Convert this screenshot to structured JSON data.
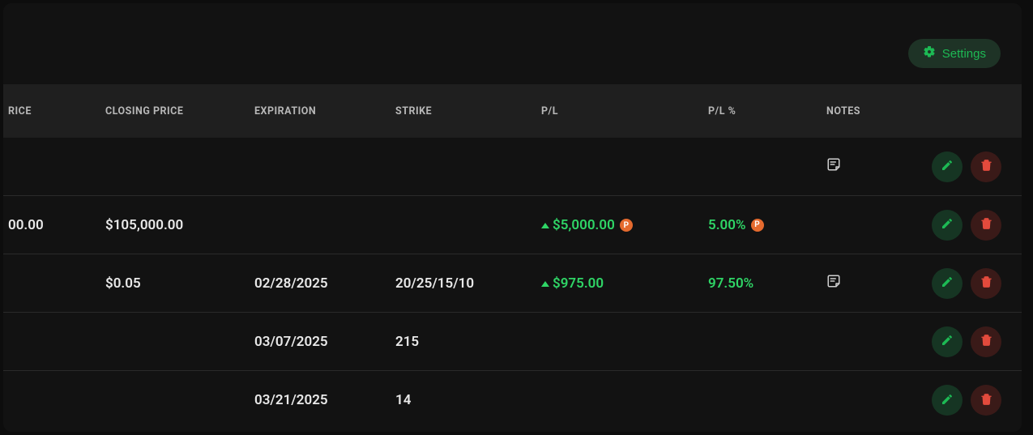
{
  "toolbar": {
    "settings_label": "Settings"
  },
  "headers": {
    "price": "RICE",
    "closing_price": "CLOSING PRICE",
    "expiration": "EXPIRATION",
    "strike": "STRIKE",
    "pl": "P/L",
    "pl_pct": "P/L %",
    "notes": "NOTES"
  },
  "badge_letter": "P",
  "rows": [
    {
      "price": "",
      "closing_price": "",
      "expiration": "",
      "strike": "",
      "pl": "",
      "pl_pct": "",
      "pl_pos": false,
      "p_badge_pl": false,
      "p_badge_pct": false,
      "has_note": true
    },
    {
      "price": "00.00",
      "closing_price": "$105,000.00",
      "expiration": "",
      "strike": "",
      "pl": "$5,000.00",
      "pl_pct": "5.00%",
      "pl_pos": true,
      "p_badge_pl": true,
      "p_badge_pct": true,
      "has_note": false
    },
    {
      "price": "",
      "closing_price": "$0.05",
      "expiration": "02/28/2025",
      "strike": "20/25/15/10",
      "pl": "$975.00",
      "pl_pct": "97.50%",
      "pl_pos": true,
      "p_badge_pl": false,
      "p_badge_pct": false,
      "has_note": true
    },
    {
      "price": "",
      "closing_price": "",
      "expiration": "03/07/2025",
      "strike": "215",
      "pl": "",
      "pl_pct": "",
      "pl_pos": false,
      "p_badge_pl": false,
      "p_badge_pct": false,
      "has_note": false
    },
    {
      "price": "",
      "closing_price": "",
      "expiration": "03/21/2025",
      "strike": "14",
      "pl": "",
      "pl_pct": "",
      "pl_pos": false,
      "p_badge_pl": false,
      "p_badge_pct": false,
      "has_note": false
    }
  ]
}
